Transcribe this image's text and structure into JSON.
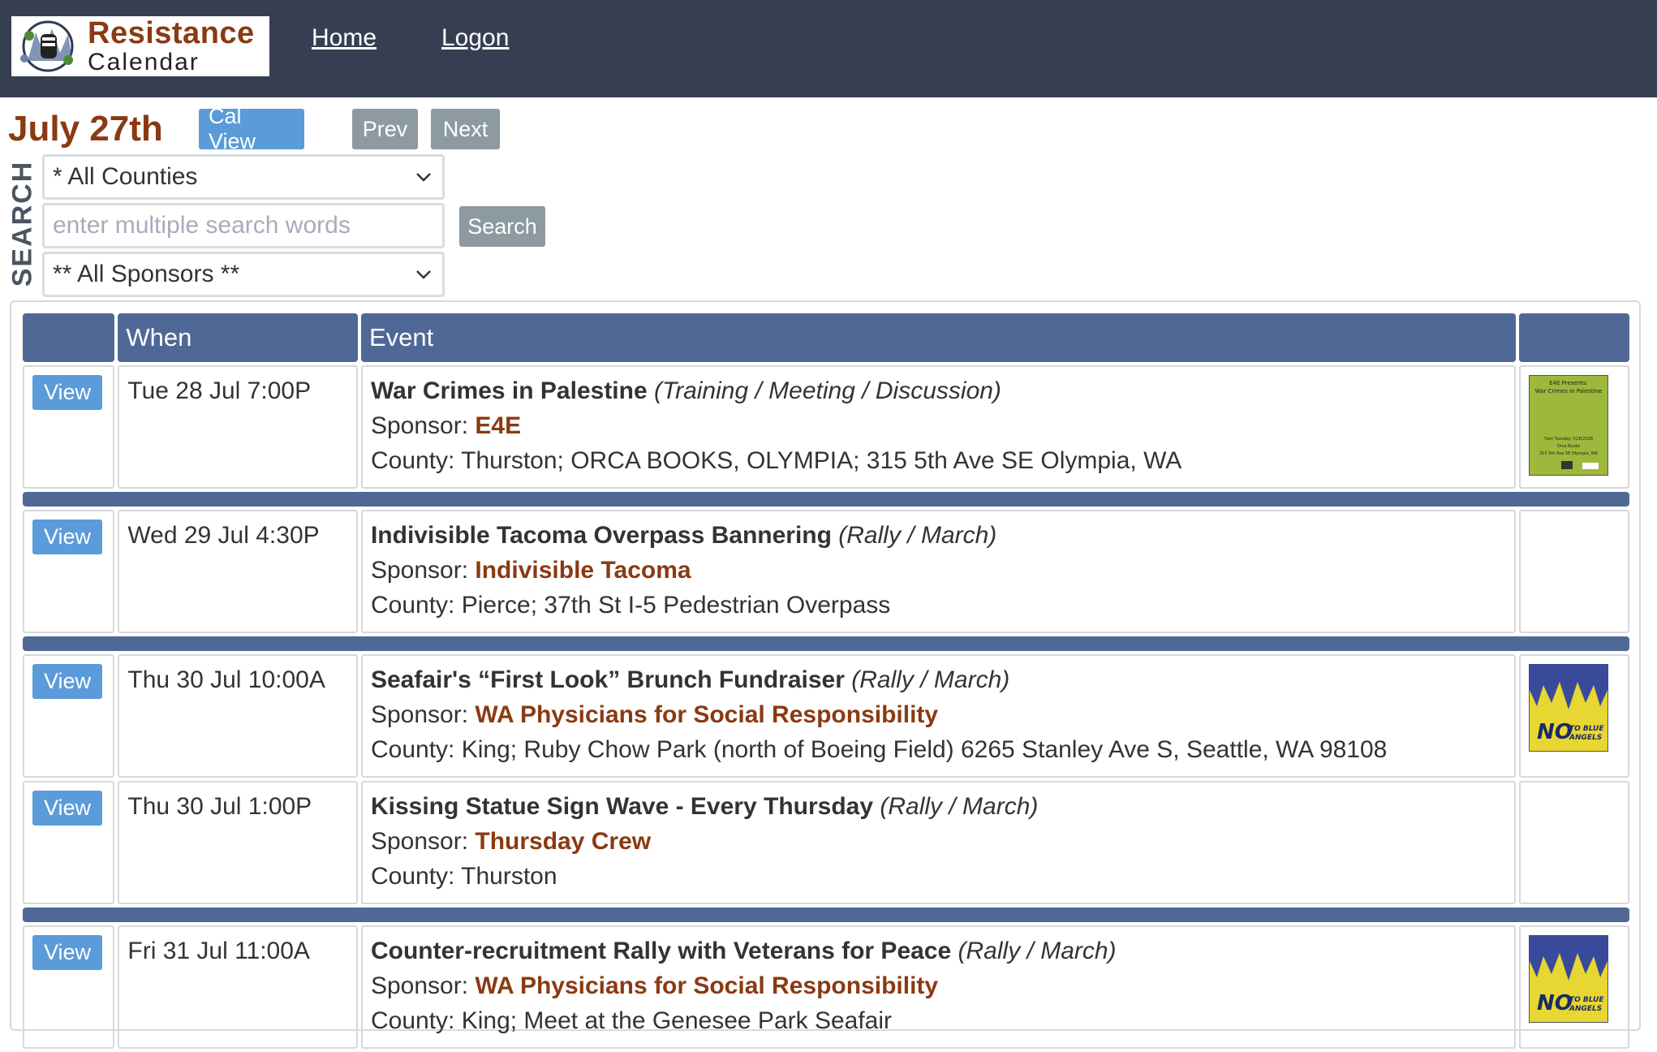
{
  "header": {
    "logo_line1": "Resistance",
    "logo_line2": "Calendar",
    "nav": {
      "home": "Home",
      "logon": "Logon"
    }
  },
  "toolbar": {
    "date_title": "July 27th",
    "cal_view": "Cal View",
    "prev": "Prev",
    "next": "Next"
  },
  "search": {
    "label": "SEARCH",
    "county_select": "* All Counties",
    "keywords_placeholder": "enter multiple search words",
    "sponsor_select": "** All Sponsors **",
    "button": "Search"
  },
  "table": {
    "headers": {
      "col0": "",
      "when": "When",
      "event": "Event",
      "col3": ""
    },
    "view_label": "View",
    "sponsor_prefix": "Sponsor: ",
    "county_prefix": "County: ",
    "rows": [
      {
        "when": "Tue 28 Jul 7:00P",
        "title": "War Crimes in Palestine",
        "type": "(Training / Meeting / Discussion)",
        "sponsor": "E4E",
        "county": "Thurston; ORCA BOOKS, OLYMPIA; 315 5th Ave SE Olympia, WA",
        "thumb": "poster-green"
      },
      {
        "when": "Wed 29 Jul 4:30P",
        "title": "Indivisible Tacoma Overpass Bannering",
        "type": "(Rally / March)",
        "sponsor": "Indivisible Tacoma",
        "county": "Pierce; 37th St I-5 Pedestrian Overpass",
        "thumb": ""
      },
      {
        "when": "Thu 30 Jul 10:00A",
        "title": "Seafair's “First Look” Brunch Fundraiser",
        "type": "(Rally / March)",
        "sponsor": "WA Physicians for Social Responsibility",
        "county": "King; Ruby Chow Park (north of Boeing Field) 6265 Stanley Ave S, Seattle, WA 98108",
        "thumb": "poster-no-blue-angels"
      },
      {
        "when": "Thu 30 Jul 1:00P",
        "title": "Kissing Statue Sign Wave - Every Thursday",
        "type": "(Rally / March)",
        "sponsor": "Thursday Crew",
        "county": "Thurston",
        "thumb": ""
      },
      {
        "when": "Fri 31 Jul 11:00A",
        "title": "Counter-recruitment Rally with Veterans for Peace",
        "type": "(Rally / March)",
        "sponsor": "WA Physicians for Social Responsibility",
        "county": "King; Meet at the Genesee Park Seafair",
        "thumb": "poster-no-blue-angels"
      }
    ]
  },
  "posters": {
    "green": {
      "l1": "E4E Presents:",
      "l2": "War Crimes in Palestine",
      "l3": "7pm Tuesday 7/28/2026",
      "l4": "Orca Books",
      "l5": "315 5th Ave SE Olympia, WA"
    },
    "blue_angels": {
      "no": "NO",
      "to": "TO BLUE",
      "angels": "ANGELS"
    }
  },
  "colors": {
    "header_bg": "#363f52",
    "brand": "#8a3a12",
    "table_header": "#4f6896",
    "button_blue": "#5b9bd9",
    "button_gray": "#8d9aa0"
  }
}
